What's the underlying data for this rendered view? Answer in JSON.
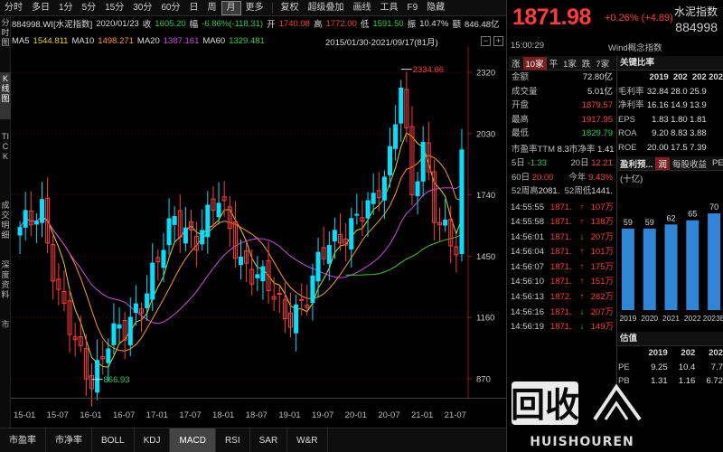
{
  "topbar": {
    "periods": [
      "分时",
      "多日",
      "1分",
      "5分",
      "15分",
      "30分",
      "60分",
      "日",
      "周",
      "月",
      "更多"
    ],
    "active_period": "月",
    "tools": [
      "复权",
      "超级叠加",
      "画线",
      "工具",
      "F9",
      "隐藏"
    ]
  },
  "leftbar": [
    "分时图",
    "K线图",
    "TICK",
    "成交明细",
    "深度资料",
    "市"
  ],
  "info": {
    "code_name": "884998.WI[水泥指数]",
    "date": "2020/01/23",
    "close_label": "收",
    "close": "1605.20",
    "change_label": "幅",
    "change": "-6.86%(-118.31)",
    "open_label": "开",
    "open": "1740.08",
    "high_label": "高",
    "high": "1772.00",
    "low_label": "低",
    "low": "1591.50",
    "amp_label": "振",
    "amp": "10.47%",
    "amount_label": "额",
    "amount": "846.48亿"
  },
  "ma": [
    {
      "label": "MA5",
      "value": "1544.811",
      "color": "#e8d400"
    },
    {
      "label": "MA10",
      "value": "1498.271",
      "color": "#ff9a1a"
    },
    {
      "label": "MA20",
      "value": "1387.161",
      "color": "#d049e0"
    },
    {
      "label": "MA60",
      "value": "1329.481",
      "color": "#33cc33"
    }
  ],
  "range": "2015/01/30-2021/09/17(81月)",
  "range_minus": "−",
  "range_plus": "+",
  "chart_data": {
    "type": "candlestick",
    "y_ticks": [
      2320,
      2030,
      1740,
      1450,
      1160,
      870
    ],
    "ylim": [
      780,
      2440
    ],
    "x_labels": [
      "15-01",
      "15-07",
      "16-01",
      "16-07",
      "17-01",
      "17-07",
      "18-01",
      "18-07",
      "19-01",
      "19-07",
      "20-01",
      "20-07",
      "21-01",
      "21-07"
    ],
    "high_annotation": "2334.66",
    "low_annotation": "866.93",
    "colors": {
      "up": "#00e0ff",
      "down": "#ff3b3b",
      "axis": "#8b1a1a"
    }
  },
  "bottom_tabs": [
    "市盈率",
    "市净率",
    "BOLL",
    "KDJ",
    "MACD",
    "RSI",
    "SAR",
    "W&R"
  ],
  "active_bottom_tab": "MACD",
  "panel": {
    "price": "1871.98",
    "change": "+0.26% (+4.89)",
    "name": "水泥指数",
    "code": "884998",
    "time": "15:00:29",
    "wind": "Wind概念指数",
    "tabs": {
      "up": "涨",
      "up_count": "10家",
      "flat": "平",
      "flat_count": "1家",
      "down": "跌",
      "down_count": "7家"
    },
    "quotes": [
      {
        "k": "金额",
        "v": "72.80亿",
        "c": "white"
      },
      {
        "k": "成交量",
        "v": "5.01亿",
        "c": "white"
      },
      {
        "k": "开盘",
        "v": "1879.57",
        "c": "red"
      },
      {
        "k": "最高",
        "v": "1917.95",
        "c": "red"
      },
      {
        "k": "最低",
        "v": "1829.79",
        "c": "green"
      }
    ],
    "pe_label": "市盈率TTM",
    "pe": "8.3",
    "pb_label": "市净率",
    "pb": "1.41",
    "d5_label": "5日",
    "d5": "-1.33",
    "d20_label": "20日",
    "d20": "12.21",
    "d60_label": "60日",
    "d60": "20.00",
    "ytd_label": "今年",
    "ytd": "9.43%",
    "h52_label": "52周高",
    "h52": "2081.",
    "l52_label": "52周低",
    "l52": "1441.",
    "trades": [
      {
        "t": "14:55:55",
        "p": "1871.",
        "d": "↑",
        "v": "107万",
        "c": "red"
      },
      {
        "t": "14:55:58",
        "p": "1871.",
        "d": "↑",
        "v": "138万",
        "c": "red"
      },
      {
        "t": "14:56:01",
        "p": "1871.",
        "d": "↓",
        "v": "207万",
        "c": "green"
      },
      {
        "t": "14:56:04",
        "p": "1871.",
        "d": "↑",
        "v": "101万",
        "c": "red"
      },
      {
        "t": "14:56:07",
        "p": "1871.",
        "d": "↑",
        "v": "175万",
        "c": "red"
      },
      {
        "t": "14:56:10",
        "p": "1871.",
        "d": "↑",
        "v": "151万",
        "c": "red"
      },
      {
        "t": "14:56:13",
        "p": "1872.",
        "d": "↑",
        "v": "282万",
        "c": "red"
      },
      {
        "t": "14:56:16",
        "p": "1871.",
        "d": "↓",
        "v": "207万",
        "c": "green"
      },
      {
        "t": "14:56:19",
        "p": "1871.",
        "d": "↓",
        "v": "149万",
        "c": "green"
      }
    ],
    "key_ratio_title": "关键比率",
    "ratio_head": [
      "",
      "2019",
      "202",
      "202",
      "202"
    ],
    "ratios": [
      [
        "毛利率",
        "32.84",
        "28.0",
        "25.9",
        ""
      ],
      [
        "净利率",
        "16.16",
        "14.9",
        "13.9",
        ""
      ],
      [
        "EPS",
        "1.83",
        "1.80",
        "1.81",
        ""
      ],
      [
        "ROA",
        "9.20",
        "8.83",
        "3.88",
        ""
      ],
      [
        "ROE",
        "20.00",
        "17.5",
        "7.39",
        ""
      ]
    ],
    "profit_tabs": [
      "盈利预...",
      "润",
      "每股收益",
      "PE"
    ],
    "profit_unit": "(十亿)",
    "profit_bars": {
      "years": [
        "2019",
        "2020",
        "2021",
        "2022",
        "2023E"
      ],
      "values": [
        59,
        59,
        62,
        65,
        70
      ]
    },
    "valuation_title": "估值",
    "valuation_head": [
      "",
      "2019",
      "202",
      "202"
    ],
    "valuation": [
      [
        "PE",
        "9.25",
        "10.4",
        "7.7"
      ],
      [
        "PB",
        "1.31",
        "1.16",
        "6.72"
      ]
    ]
  },
  "watermark": {
    "big": "回收",
    "small": "HUISHOUREN"
  }
}
